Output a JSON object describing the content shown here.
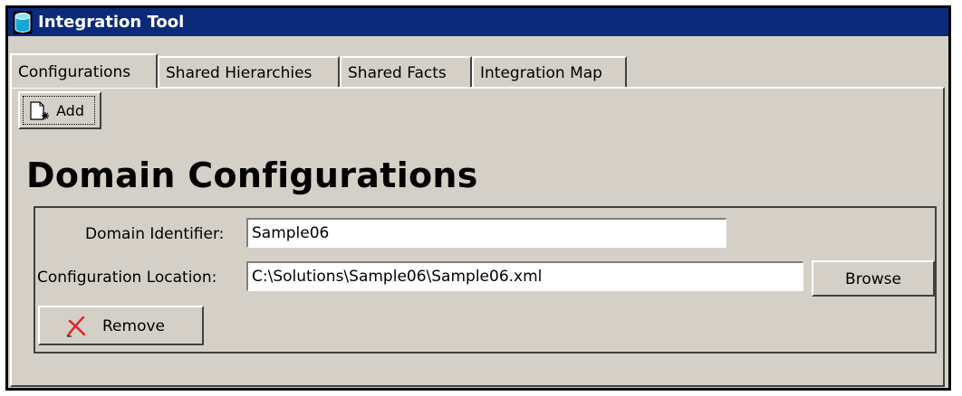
{
  "window": {
    "title": "Integration Tool",
    "title_bar_color": "#0b2b7a",
    "background_color": "#d4d0c8"
  },
  "tabs": [
    {
      "label": "Configurations",
      "active": true
    },
    {
      "label": "Shared Hierarchies",
      "active": false
    },
    {
      "label": "Shared Facts",
      "active": false
    },
    {
      "label": "Integration Map",
      "active": false
    }
  ],
  "toolbar": {
    "add_label": "Add",
    "add_icon": "new-document-icon"
  },
  "main": {
    "heading": "Domain Configurations",
    "domain_identifier_label": "Domain Identifier:",
    "domain_identifier_value": "Sample06",
    "configuration_location_label": "Configuration Location:",
    "configuration_location_value": "C:\\Solutions\\Sample06\\Sample06.xml",
    "browse_label": "Browse",
    "remove_label": "Remove",
    "remove_icon": "red-x-icon",
    "remove_icon_color": "#e0282c"
  }
}
